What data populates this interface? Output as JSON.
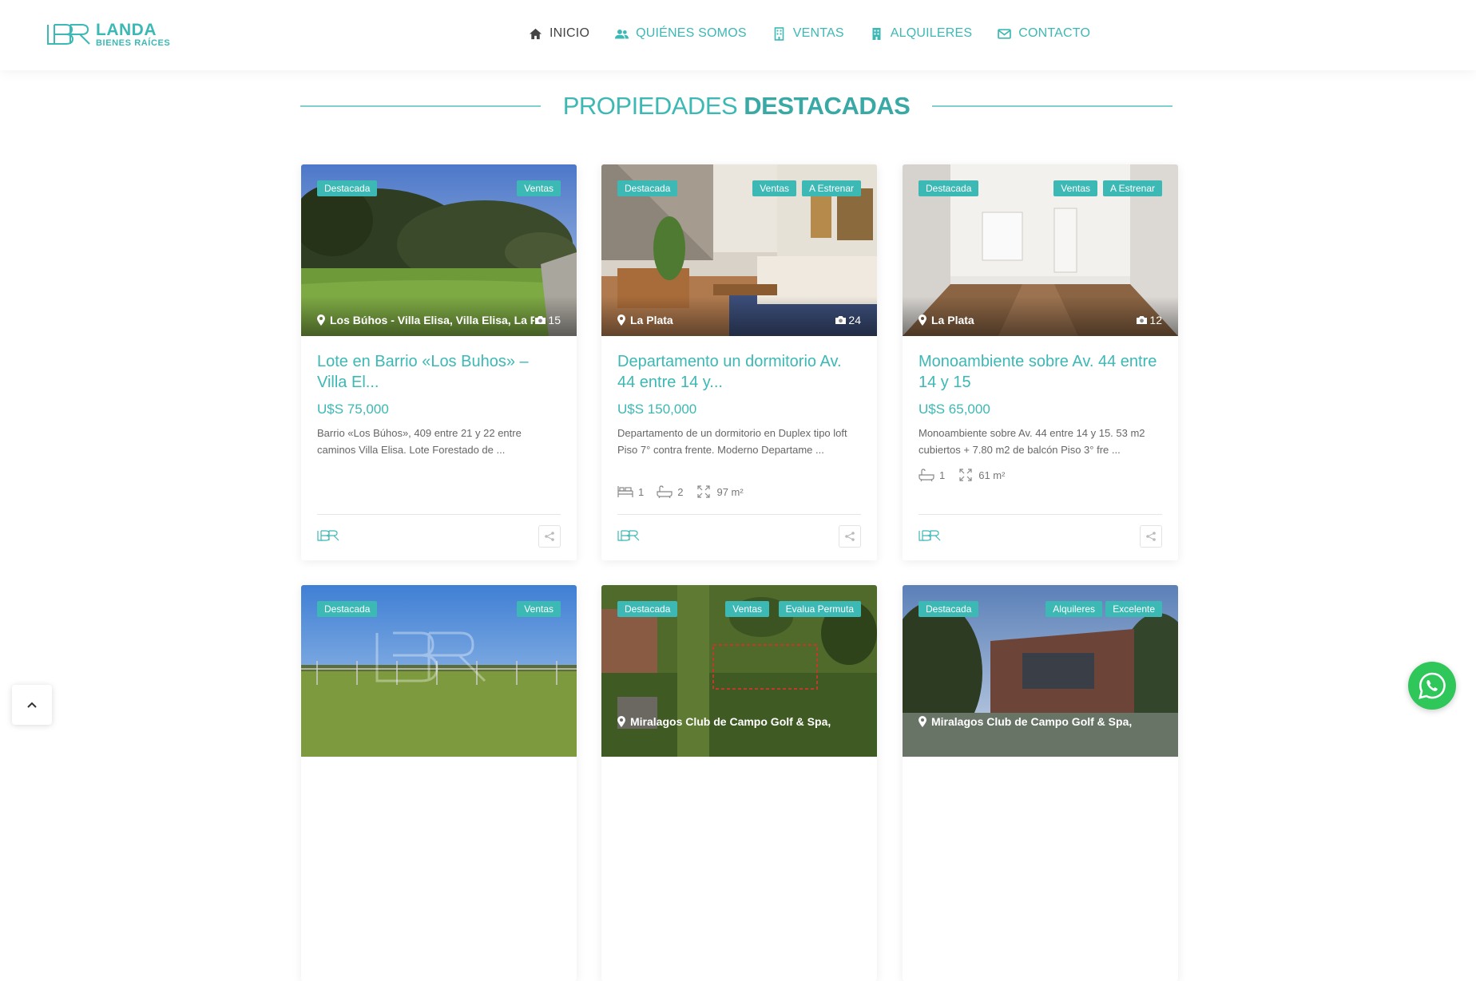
{
  "brand": {
    "name": "LANDA",
    "subtitle": "BIENES RAÍCES",
    "accent": "#3cb8b5"
  },
  "nav": [
    {
      "label": "INICIO",
      "icon": "home-icon",
      "active": true
    },
    {
      "label": "QUIÉNES SOMOS",
      "icon": "users-icon"
    },
    {
      "label": "VENTAS",
      "icon": "building-icon"
    },
    {
      "label": "ALQUILERES",
      "icon": "building-icon"
    },
    {
      "label": "CONTACTO",
      "icon": "envelope-icon"
    }
  ],
  "section": {
    "title_light": "PROPIEDADES",
    "title_bold": "DESTACADAS"
  },
  "cards": [
    {
      "badge_left": "Destacada",
      "badges_right": [
        "Ventas"
      ],
      "location": "Los Búhos - Villa Elisa, Villa Elisa, La Plata",
      "photos": "15",
      "title": "Lote en Barrio «Los Buhos» – Villa El...",
      "price": "U$S 75,000",
      "description": "Barrio «Los Búhos», 409 entre 21 y 22 entre caminos Villa Elisa.   Lote Forestado de ...",
      "features": []
    },
    {
      "badge_left": "Destacada",
      "badges_right": [
        "Ventas",
        "A Estrenar"
      ],
      "location": "La Plata",
      "photos": "24",
      "title": "Departamento un dormitorio Av. 44 entre 14 y...",
      "price": "U$S 150,000",
      "description": "Departamento de un dormitorio en Duplex tipo loft Piso 7° contra frente. Moderno Departame ...",
      "features": [
        {
          "icon": "bed-icon",
          "value": "1"
        },
        {
          "icon": "bath-icon",
          "value": "2"
        },
        {
          "icon": "area-icon",
          "value": "97 m²"
        }
      ]
    },
    {
      "badge_left": "Destacada",
      "badges_right": [
        "Ventas",
        "A Estrenar"
      ],
      "location": "La Plata",
      "photos": "12",
      "title": "Monoambiente sobre Av. 44 entre 14 y 15",
      "price": "U$S 65,000",
      "description": "Monoambiente sobre Av. 44 entre 14 y 15.   53 m2 cubiertos + 7.80 m2 de balcón Piso 3° fre ...",
      "features": [
        {
          "icon": "bath-icon",
          "value": "1"
        },
        {
          "icon": "area-icon",
          "value": "61 m²"
        }
      ]
    },
    {
      "badge_left": "Destacada",
      "badges_right": [
        "Ventas"
      ],
      "location": "",
      "photos": ""
    },
    {
      "badge_left": "Destacada",
      "badges_right": [
        "Ventas",
        "Evalua Permuta"
      ],
      "location": "Miralagos Club de Campo Golf & Spa, La",
      "photos": ""
    },
    {
      "badge_left": "Destacada",
      "badges_right": [
        "Alquileres",
        "Excelente"
      ],
      "location": "Miralagos Club de Campo Golf & Spa, La",
      "photos": ""
    }
  ]
}
